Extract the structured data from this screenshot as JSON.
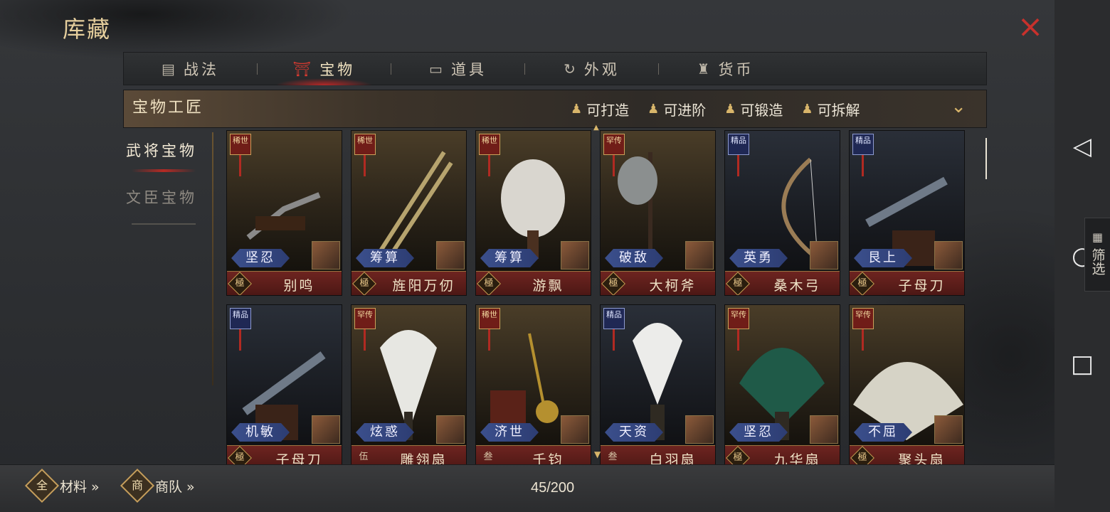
{
  "header": {
    "title": "库藏",
    "close_icon": "×"
  },
  "tabs": [
    {
      "label": "战法",
      "icon": "scroll-icon",
      "glyph": "▤"
    },
    {
      "label": "宝物",
      "icon": "treasure-icon",
      "glyph": "⛩"
    },
    {
      "label": "道具",
      "icon": "box-icon",
      "glyph": "▭"
    },
    {
      "label": "外观",
      "icon": "swirl-icon",
      "glyph": "↻"
    },
    {
      "label": "货币",
      "icon": "coin-bag-icon",
      "glyph": "♜"
    }
  ],
  "active_tab": "宝物",
  "craft_bar": {
    "title": "宝物工匠",
    "filters": [
      "可打造",
      "可进阶",
      "可锻造",
      "可拆解"
    ],
    "expand_icon": "⌄"
  },
  "side_nav": [
    {
      "label": "武将宝物",
      "active": true
    },
    {
      "label": "文臣宝物",
      "active": false
    }
  ],
  "items": [
    {
      "badge": "稀世",
      "skill": "坚忍",
      "grade": "極",
      "name": "别鸣",
      "tier": "g"
    },
    {
      "badge": "稀世",
      "skill": "筹算",
      "grade": "極",
      "name": "旌阳万仞",
      "tier": "g"
    },
    {
      "badge": "稀世",
      "skill": "筹算",
      "grade": "極",
      "name": "游飘",
      "tier": "g"
    },
    {
      "badge": "罕传",
      "skill": "破敌",
      "grade": "極",
      "name": "大柯斧",
      "tier": "g"
    },
    {
      "badge": "精品",
      "skill": "英勇",
      "grade": "極",
      "name": "桑木弓",
      "tier": "b"
    },
    {
      "badge": "精品",
      "skill": "艮上",
      "grade": "極",
      "name": "子母刀",
      "tier": "b"
    },
    {
      "badge": "精品",
      "skill": "机敏",
      "grade": "極",
      "name": "子母刀",
      "tier": "b"
    },
    {
      "badge": "罕传",
      "skill": "炫惑",
      "grade": "伍",
      "name": "雕翎扇",
      "tier": "g"
    },
    {
      "badge": "稀世",
      "skill": "济世",
      "grade": "叁",
      "name": "千钧",
      "tier": "g"
    },
    {
      "badge": "精品",
      "skill": "天资",
      "grade": "叁",
      "name": "白羽扇",
      "tier": "b"
    },
    {
      "badge": "罕传",
      "skill": "坚忍",
      "grade": "極",
      "name": "九华扇",
      "tier": "g"
    },
    {
      "badge": "罕传",
      "skill": "不屈",
      "grade": "極",
      "name": "聚头扇",
      "tier": "g"
    }
  ],
  "footer": {
    "materials_label": "材料 »",
    "materials_icon": "全",
    "caravan_label": "商队 »",
    "caravan_icon": "商",
    "count": "45/200"
  },
  "system_nav": {
    "back": "◁",
    "home": "○",
    "recents": "□"
  },
  "sift_button": {
    "label": "筛选",
    "icon": "grid-icon"
  },
  "colors": {
    "accent_red": "#c8312c",
    "gold": "#d8b56a",
    "skill_blue": "#3b4f8c"
  }
}
